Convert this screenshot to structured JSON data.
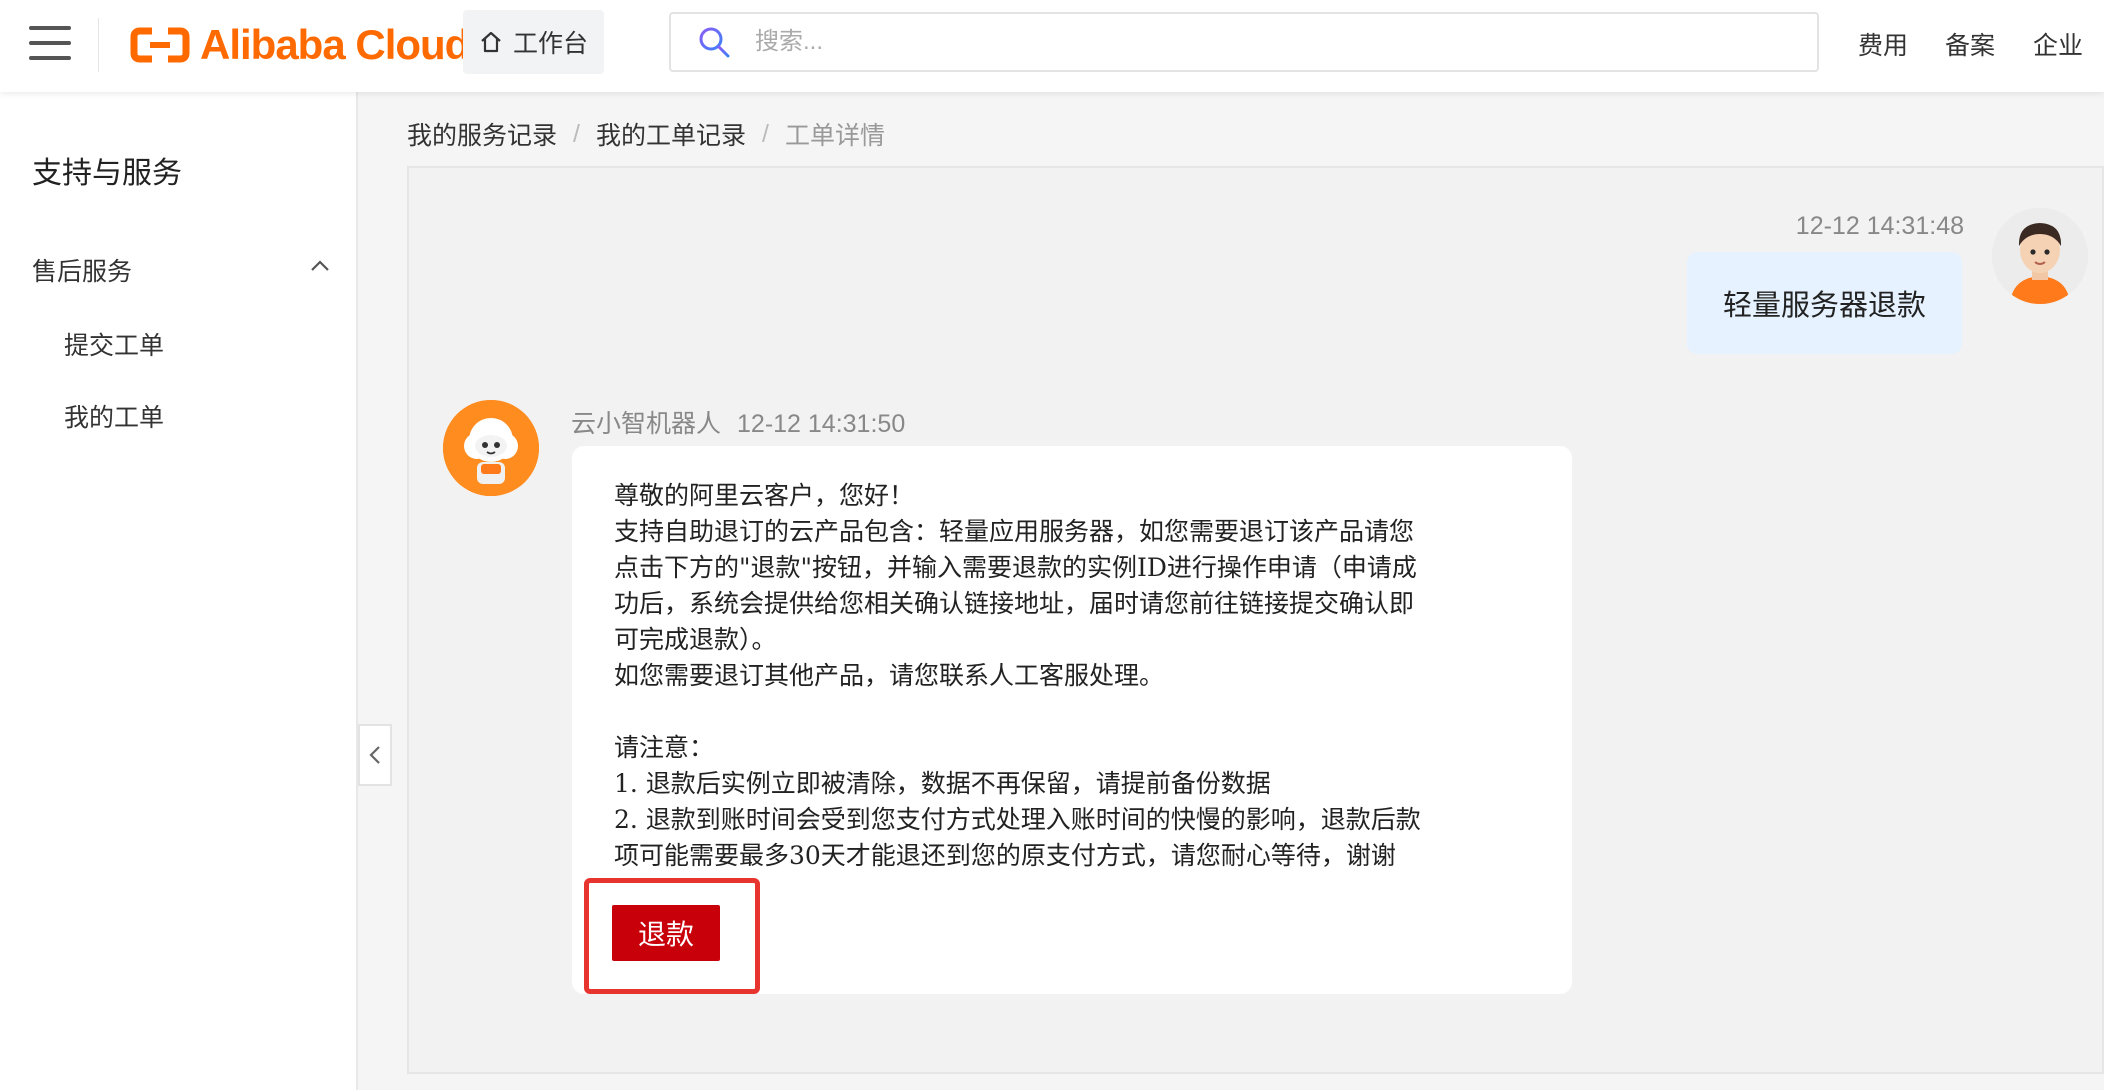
{
  "header": {
    "brand": "Alibaba Cloud",
    "workbench_label": "工作台",
    "search_placeholder": "搜索...",
    "nav": [
      "费用",
      "备案",
      "企业"
    ]
  },
  "colors": {
    "brand": "#ff6a00",
    "refund_button": "#c8000a",
    "highlight": "#e8342f",
    "user_bubble": "#e6f2ff"
  },
  "sidebar": {
    "title": "支持与服务",
    "group_label": "售后服务",
    "group_expanded": true,
    "items": [
      "提交工单",
      "我的工单"
    ]
  },
  "breadcrumb": [
    "我的服务记录",
    "我的工单记录",
    "工单详情"
  ],
  "chat": {
    "user_message": {
      "time": "12-12 14:31:48",
      "text": "轻量服务器退款"
    },
    "bot_message": {
      "name": "云小智机器人",
      "time": "12-12 14:31:50",
      "text": "尊敬的阿里云客户，您好！\n支持自助退订的云产品包含：轻量应用服务器，如您需要退订该产品请您\n点击下方的\"退款\"按钮，并输入需要退款的实例ID进行操作申请（申请成\n功后，系统会提供给您相关确认链接地址，届时请您前往链接提交确认即\n可完成退款）。\n如您需要退订其他产品，请您联系人工客服处理。\n\n请注意：\n1. 退款后实例立即被清除，数据不再保留，请提前备份数据\n2. 退款到账时间会受到您支付方式处理入账时间的快慢的影响，退款后款\n项可能需要最多30天才能退还到您的原支付方式，请您耐心等待，谢谢",
      "button_label": "退款"
    }
  }
}
